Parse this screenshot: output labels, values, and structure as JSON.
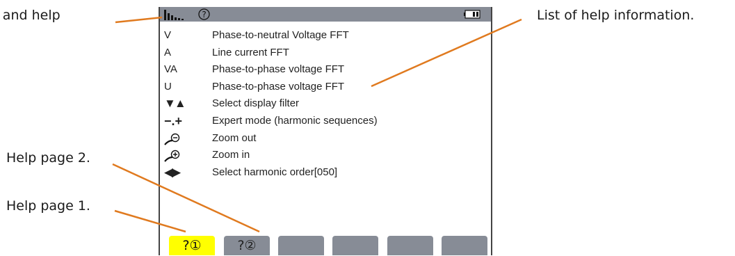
{
  "callouts": {
    "mode": "Mode and help",
    "list": "List of help information.",
    "page2": "Help page 2.",
    "page1": "Help page 1."
  },
  "topbar": {
    "mode_icon": "harmonics-bars-icon",
    "help_icon": "help-circle-icon",
    "battery_icon": "battery-icon"
  },
  "help_items": [
    {
      "symbol": "V",
      "label": "Phase-to-neutral Voltage FFT"
    },
    {
      "symbol": "A",
      "label": "Line current FFT"
    },
    {
      "symbol": "VA",
      "label": "Phase-to-phase voltage FFT"
    },
    {
      "symbol": "U",
      "label": "Phase-to-phase voltage FFT"
    },
    {
      "symbol": "▼▲",
      "label": "Select display filter"
    },
    {
      "symbol": "−.+",
      "label": "Expert mode (harmonic sequences)"
    },
    {
      "symbol": "zoom-out-icon",
      "label": "Zoom out"
    },
    {
      "symbol": "zoom-in-icon",
      "label": "Zoom in"
    },
    {
      "symbol": "◀▶",
      "label": "Select harmonic order[050]"
    }
  ],
  "function_keys": [
    {
      "label": "?①"
    },
    {
      "label": "?②"
    },
    {
      "label": ""
    },
    {
      "label": ""
    },
    {
      "label": ""
    },
    {
      "label": ""
    }
  ],
  "colors": {
    "topbar": "#878c96",
    "active_key": "#ffff00",
    "leader_line": "#e07a1f"
  }
}
